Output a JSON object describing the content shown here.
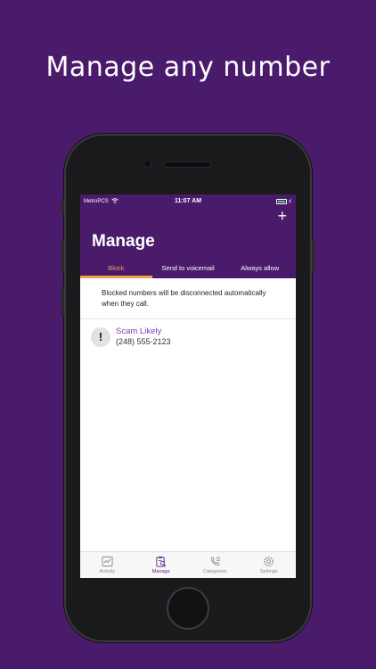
{
  "headline": "Manage any number",
  "status_bar": {
    "carrier": "MetroPCS",
    "time": "11:07 AM"
  },
  "header": {
    "title": "Manage",
    "add_icon": "+"
  },
  "tabs": [
    {
      "label": "Block",
      "active": true
    },
    {
      "label": "Send to voicemail",
      "active": false
    },
    {
      "label": "Always allow",
      "active": false
    }
  ],
  "info_text": "Blocked numbers will be disconnected automatically when they call.",
  "blocked_list": [
    {
      "name": "Scam Likely",
      "number": "(248) 555-2123",
      "icon": "exclamation-icon"
    }
  ],
  "bottom_nav": [
    {
      "label": "Activity",
      "icon": "activity-chart-icon",
      "active": false
    },
    {
      "label": "Manage",
      "icon": "manage-clipboard-icon",
      "active": true
    },
    {
      "label": "Categories",
      "icon": "categories-phone-icon",
      "active": false
    },
    {
      "label": "Settings",
      "icon": "gear-icon",
      "active": false
    }
  ],
  "colors": {
    "brand_purple": "#4a1a6b",
    "accent_orange": "#f0a050",
    "link_purple": "#7a3fb0"
  }
}
